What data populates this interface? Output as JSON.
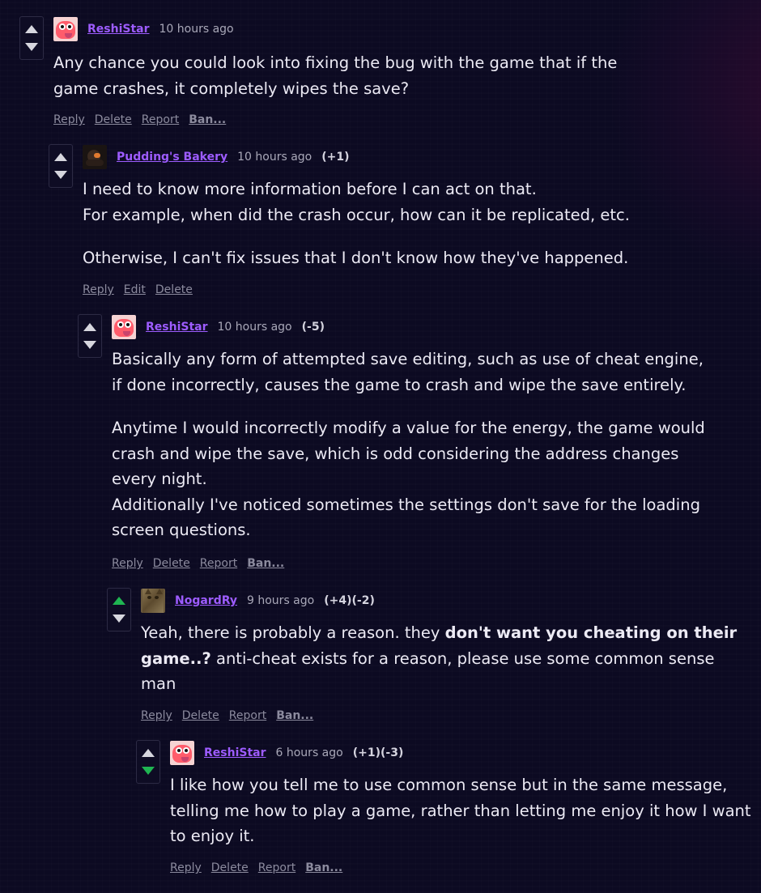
{
  "comments": [
    {
      "user": "ReshiStar",
      "time": "10 hours ago",
      "score": "",
      "lines": [
        "Any chance you could look into fixing the bug with the game that if the",
        "game crashes, it completely wipes the save?"
      ],
      "actions": [
        "Reply",
        "Delete",
        "Report",
        "Ban..."
      ]
    },
    {
      "user": "Pudding's Bakery",
      "time": "10 hours ago",
      "score": "(+1)",
      "lines": [
        "I need to know more information before I can act on that.",
        "For example, when did the crash occur, how can it be replicated, etc.",
        "",
        "Otherwise, I can't fix issues that I don't know how they've happened."
      ],
      "actions": [
        "Reply",
        "Edit",
        "Delete"
      ]
    },
    {
      "user": "ReshiStar",
      "time": "10 hours ago",
      "score": "(-5)",
      "lines": [
        "Basically any form of attempted save editing, such as use of cheat engine,",
        "if done incorrectly, causes the game to crash and wipe the save entirely.",
        "",
        "Anytime I would incorrectly modify a value for the energy, the game would",
        "crash and wipe the save, which is odd considering the address changes",
        "every night.",
        "Additionally I've noticed sometimes the settings don't save for the loading",
        "screen questions."
      ],
      "actions": [
        "Reply",
        "Delete",
        "Report",
        "Ban..."
      ]
    },
    {
      "user": "NogardRy",
      "time": "9 hours ago",
      "score": "(+4)(-2)",
      "line1_pre": "Yeah, there is probably a reason. they ",
      "line1_bold": "don't want you cheating on their",
      "line2_bold": "game..?",
      "line2_post": " anti-cheat exists for a reason, please use some common sense",
      "line3": "man",
      "actions": [
        "Reply",
        "Delete",
        "Report",
        "Ban..."
      ]
    },
    {
      "user": "ReshiStar",
      "time": "6 hours ago",
      "score": "(+1)(-3)",
      "lines": [
        "I like how you tell me to use common sense but in the same message,",
        "telling me how to play a game, rather than letting me enjoy it how I want",
        "to enjoy it."
      ],
      "actions": [
        "Reply",
        "Delete",
        "Report",
        "Ban..."
      ]
    }
  ],
  "vote_colors": {
    "default": "#d6d6de",
    "active": "#1fb552"
  },
  "avatar_icons": [
    "reshi-avatar-icon",
    "pudding-avatar-icon",
    "reshi-avatar-icon",
    "cat-avatar-icon",
    "reshi-avatar-icon"
  ]
}
